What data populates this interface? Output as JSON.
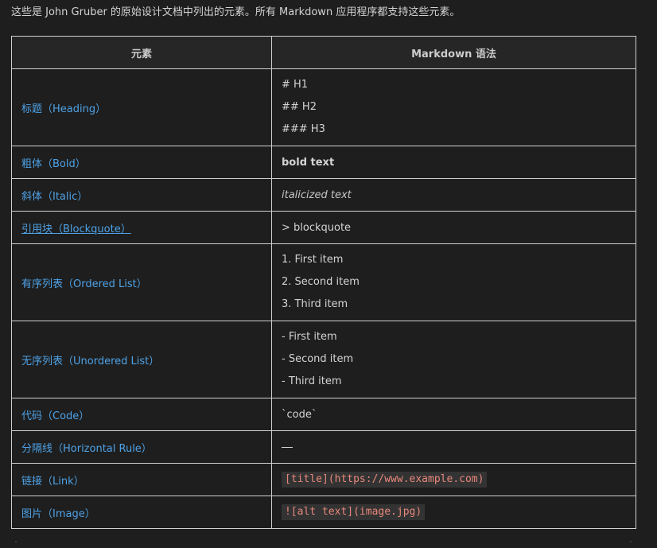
{
  "intro": "这些是 John Gruber 的原始设计文档中列出的元素。所有 Markdown 应用程序都支持这些元素。",
  "table": {
    "headers": [
      "元素",
      "Markdown 语法"
    ],
    "rows": [
      {
        "element": "标题（Heading）",
        "syntax": [
          "# H1",
          "## H2",
          "### H3"
        ]
      },
      {
        "element": "粗体（Bold）",
        "syntax": [
          "bold text"
        ]
      },
      {
        "element": "斜体（Italic）",
        "syntax": [
          "italicized text"
        ]
      },
      {
        "element": "引用块（Blockquote）",
        "syntax": [
          "> blockquote"
        ]
      },
      {
        "element": "有序列表（Ordered List）",
        "syntax": [
          "1. First item",
          "2. Second item",
          "3. Third item"
        ]
      },
      {
        "element": "无序列表（Unordered List）",
        "syntax": [
          "- First item",
          "- Second item",
          "- Third item"
        ]
      },
      {
        "element": "代码（Code）",
        "syntax": [
          "`code`"
        ]
      },
      {
        "element": "分隔线（Horizontal Rule）",
        "syntax": [
          "---"
        ]
      },
      {
        "element": "链接（Link）",
        "syntax": [
          "[title](https://www.example.com)"
        ]
      },
      {
        "element": "图片（Image）",
        "syntax": [
          "![alt text](image.jpg)"
        ]
      }
    ]
  },
  "colors": {
    "background": "#1e1e1e",
    "element_link": "#4ea2e6",
    "code_text": "#e8877b",
    "code_bg": "#333333",
    "border": "#d0d0d0"
  }
}
